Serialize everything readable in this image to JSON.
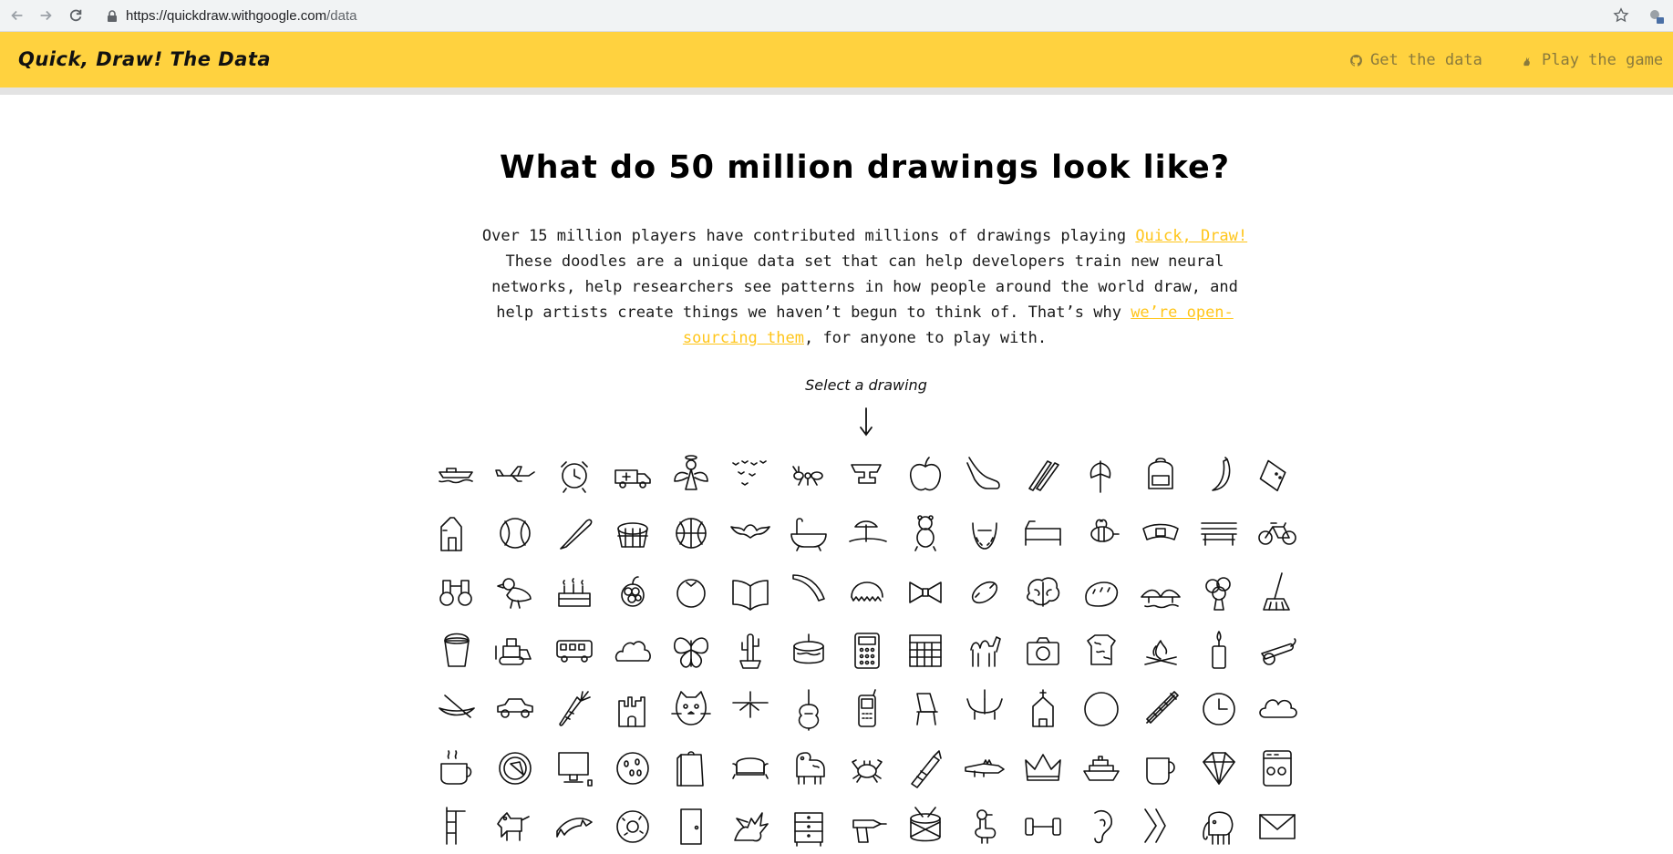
{
  "browser": {
    "url_host": "https://quickdraw.withgoogle.com",
    "url_path": "/data"
  },
  "header": {
    "brand": "Quick, Draw! The Data",
    "get_data_label": "Get the data",
    "play_game_label": "Play the game"
  },
  "main": {
    "title": "What do 50 million drawings look like?",
    "intro_part1": "Over 15 million players have contributed millions of drawings playing ",
    "intro_link1": "Quick, Draw!",
    "intro_part2": " These doodles are a unique data set that can help developers train new neural networks, help researchers see patterns in how people around the world draw, and help artists create things we haven’t begun to think of. That’s why ",
    "intro_link2": "we’re open-sourcing them",
    "intro_part3": ", for anyone to play with.",
    "select_label": "Select a drawing"
  },
  "colors": {
    "header_bg": "#ffd23f",
    "link": "#ffc51a",
    "header_link": "#8a7a3c"
  },
  "drawings": [
    [
      "aircraft-carrier",
      "airplane",
      "alarm-clock",
      "ambulance",
      "angel",
      "animal-migration",
      "ant",
      "anvil",
      "apple",
      "arm",
      "asparagus",
      "axe",
      "backpack",
      "banana",
      "bandage"
    ],
    [
      "barn",
      "baseball",
      "baseball-bat",
      "basket",
      "basketball",
      "bat",
      "bathtub",
      "beach",
      "bear",
      "beard",
      "bed",
      "bee",
      "belt",
      "bench",
      "bicycle"
    ],
    [
      "binoculars",
      "bird",
      "birthday-cake",
      "blackberry",
      "blueberry",
      "book",
      "boomerang",
      "bottlecap",
      "bowtie",
      "bracelet",
      "brain",
      "bread",
      "bridge",
      "broccoli",
      "broom"
    ],
    [
      "bucket",
      "bulldozer",
      "bus",
      "bush",
      "butterfly",
      "cactus",
      "cake",
      "calculator",
      "calendar",
      "camel",
      "camera",
      "camouflage",
      "campfire",
      "candle",
      "cannon"
    ],
    [
      "canoe",
      "car",
      "carrot",
      "castle",
      "cat",
      "ceiling-fan",
      "cello",
      "cell-phone",
      "chair",
      "chandelier",
      "church",
      "circle",
      "clarinet",
      "clock",
      "cloud"
    ],
    [
      "coffee-cup",
      "compass",
      "computer",
      "cookie",
      "cooler",
      "couch",
      "cow",
      "crab",
      "crayon",
      "crocodile",
      "crown",
      "cruise-ship",
      "cup",
      "diamond",
      "dishwasher"
    ],
    [
      "diving-board",
      "dog",
      "dolphin",
      "donut",
      "door",
      "dragon",
      "dresser",
      "drill",
      "drums",
      "duck",
      "dumbbell",
      "ear",
      "elbow",
      "elephant",
      "envelope"
    ]
  ]
}
